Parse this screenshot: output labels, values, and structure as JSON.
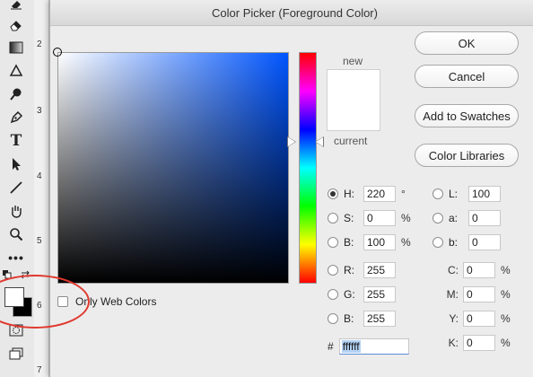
{
  "ruler": {
    "ticks": [
      "2",
      "3",
      "4",
      "5",
      "6",
      "7"
    ]
  },
  "toolbar": {
    "tools": [
      "eraser-icon",
      "gradient-icon",
      "blur-icon",
      "dodge-icon",
      "pen-icon",
      "type-icon",
      "path-selection-icon",
      "line-icon",
      "hand-icon",
      "zoom-icon",
      "more-tools-icon",
      "quick-mask-icon",
      "screen-mode-icon"
    ],
    "foreground_color": "#ffffff",
    "background_color": "#000000",
    "annotation_color": "#e0392e"
  },
  "dialog": {
    "title": "Color Picker (Foreground Color)",
    "preview": {
      "new_label": "new",
      "current_label": "current",
      "new_color": "#ffffff",
      "current_color": "#ffffff"
    },
    "buttons": {
      "ok": "OK",
      "cancel": "Cancel",
      "add_to_swatches": "Add to Swatches",
      "color_libraries": "Color Libraries"
    },
    "only_web_colors": {
      "label": "Only Web Colors",
      "checked": false
    },
    "hsb": {
      "h": {
        "label": "H:",
        "value": "220",
        "unit": "°",
        "selected": true
      },
      "s": {
        "label": "S:",
        "value": "0",
        "unit": "%",
        "selected": false
      },
      "b": {
        "label": "B:",
        "value": "100",
        "unit": "%",
        "selected": false
      }
    },
    "rgb": {
      "r": {
        "label": "R:",
        "value": "255"
      },
      "g": {
        "label": "G:",
        "value": "255"
      },
      "b": {
        "label": "B:",
        "value": "255"
      }
    },
    "lab": {
      "l": {
        "label": "L:",
        "value": "100"
      },
      "a": {
        "label": "a:",
        "value": "0"
      },
      "b": {
        "label": "b:",
        "value": "0"
      }
    },
    "cmyk": {
      "c": {
        "label": "C:",
        "value": "0",
        "unit": "%"
      },
      "m": {
        "label": "M:",
        "value": "0",
        "unit": "%"
      },
      "y": {
        "label": "Y:",
        "value": "0",
        "unit": "%"
      },
      "k": {
        "label": "K:",
        "value": "0",
        "unit": "%"
      }
    },
    "hex": {
      "label": "#",
      "value": "ffffff"
    }
  }
}
